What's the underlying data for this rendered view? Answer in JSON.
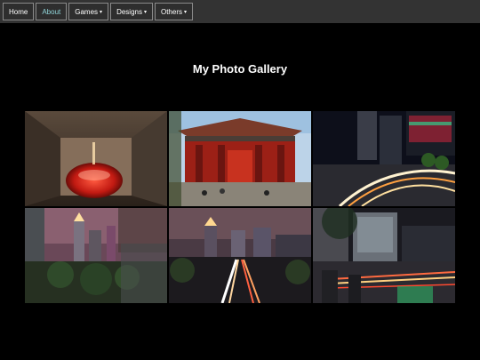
{
  "nav": {
    "items": [
      {
        "label": "Home",
        "active": false,
        "has_dropdown": false
      },
      {
        "label": "About",
        "active": true,
        "has_dropdown": false
      },
      {
        "label": "Games",
        "active": false,
        "has_dropdown": true
      },
      {
        "label": "Designs",
        "active": false,
        "has_dropdown": true
      },
      {
        "label": "Others",
        "active": false,
        "has_dropdown": true
      }
    ],
    "dropdown_caret": "▾"
  },
  "page": {
    "title": "My Photo Gallery"
  },
  "gallery": {
    "photos": [
      {
        "name": "photo-red-lamp"
      },
      {
        "name": "photo-temple"
      },
      {
        "name": "photo-night-street-lights"
      },
      {
        "name": "photo-city-skyline-night"
      },
      {
        "name": "photo-traffic-light-trails"
      },
      {
        "name": "photo-crossing-night"
      }
    ]
  },
  "colors": {
    "nav_bg": "#333333",
    "nav_active_text": "#8fd3d8",
    "page_bg": "#000000"
  }
}
